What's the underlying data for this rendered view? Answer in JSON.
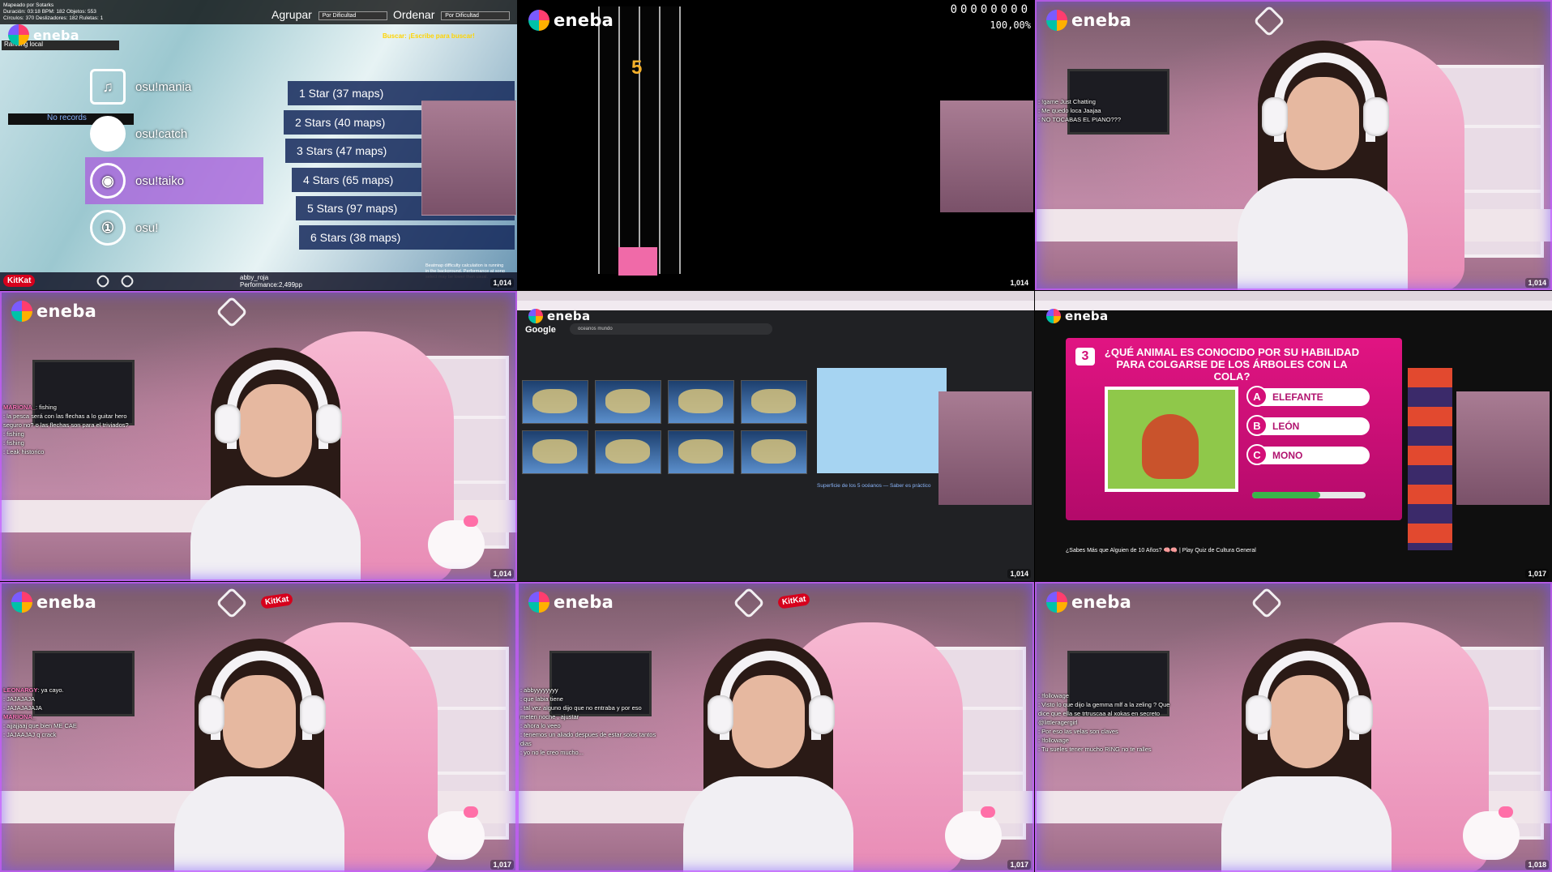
{
  "brand": {
    "eneba": "eneba",
    "kitkat": "KitKat"
  },
  "viewers": [
    "1,014",
    "1,014",
    "1,014",
    "1,014",
    "1,014",
    "1,017",
    "1,017",
    "1,017",
    "1,018"
  ],
  "osu": {
    "info_lines": [
      "Mapeado por Sotarks",
      "Duración: 03:18 BPM: 182 Objetos: 553",
      "Círculos: 370 Deslizadores: 182 Ruletas: 1"
    ],
    "group_label": "Agrupar",
    "group_value": "Por Dificultad",
    "order_label": "Ordenar",
    "order_value": "Por Dificultad",
    "ranking": "Ranking local",
    "search": "Buscar: ¡Escribe para buscar!",
    "no_records": "No records",
    "modes": [
      {
        "label": "osu!mania",
        "icon": "piano-icon"
      },
      {
        "label": "osu!catch",
        "icon": "apple-icon"
      },
      {
        "label": "osu!taiko",
        "icon": "drum-icon"
      },
      {
        "label": "osu!",
        "icon": "osu-circle-icon"
      }
    ],
    "mode_glyphs": [
      "♫",
      "",
      "◉",
      "①"
    ],
    "stars": [
      "1 Star (37 maps)",
      "2 Stars (40 maps)",
      "3 Stars (47 maps)",
      "4 Stars (65 maps)",
      "5 Stars (97 maps)",
      "6 Stars (38 maps)"
    ],
    "player": "abby_roja",
    "player_sub": "Performance:2,499pp",
    "tooltip": "Beatmap difficulty calculation is running in the background. Performance at song select may be lower than usual."
  },
  "mania": {
    "combo": "5",
    "score": "00000000",
    "accuracy": "100,00%"
  },
  "google": {
    "logo": "Google",
    "query": "oceanos mundo",
    "panel_title": "Superficie de los 5 océanos — Saber es práctico"
  },
  "quiz": {
    "number": "3",
    "question": "¿QUÉ ANIMAL ES CONOCIDO POR SU HABILIDAD PARA COLGARSE DE LOS ÁRBOLES CON LA COLA?",
    "options": [
      {
        "letter": "A",
        "text": "ELEFANTE"
      },
      {
        "letter": "B",
        "text": "LEÓN"
      },
      {
        "letter": "C",
        "text": "MONO"
      }
    ],
    "timer_fraction": 0.6,
    "video_title": "¿Sabes Más que Alguien de 10 Años? 🧠🧠 | Play Quiz de Cultura General"
  },
  "chats": {
    "t2": [
      {
        "u": "",
        "m": ": !game Just Chatting"
      },
      {
        "u": "",
        "m": ": Me quedo loca Jaajaa"
      },
      {
        "u": "",
        "m": ": NO TOCABAS EL PIANO???"
      }
    ],
    "t3": [
      {
        "u": "MARIONA_",
        "m": ": fishing"
      },
      {
        "u": "",
        "m": ": la pesca será con las flechas a lo guitar hero seguro no? o las flechas son para el triviados?"
      },
      {
        "u": "",
        "m": ": fishing"
      },
      {
        "u": "",
        "m": ": fishing"
      },
      {
        "u": "",
        "m": ": Leak historico"
      }
    ],
    "t6": [
      {
        "u": "LEONARGY",
        "m": ": ya cayo."
      },
      {
        "u": "",
        "m": ": JAJAJAJA"
      },
      {
        "u": "",
        "m": ": JAJAJAJAJA"
      },
      {
        "u": "MARIONA_",
        "m": ""
      },
      {
        "u": "",
        "m": ": ajjajjaaj que bien ME CAE"
      },
      {
        "u": "",
        "m": ": JAJAAJAJ q crack"
      }
    ],
    "t7": [
      {
        "u": "",
        "m": ": abbyyyyyyyy"
      },
      {
        "u": "",
        "m": ": que labia tiene"
      },
      {
        "u": "",
        "m": ": tal vez alguno dijo que no entraba y por eso meten noche , ajustar"
      },
      {
        "u": "",
        "m": ": ahora lo veeo"
      },
      {
        "u": "",
        "m": ": tenemos un aliado despues de estar solos tantos dias"
      },
      {
        "u": "",
        "m": ": yo no le creo mucho..."
      }
    ],
    "t8": [
      {
        "u": "",
        "m": ": !followage"
      },
      {
        "u": "",
        "m": ": Visto lo que dijo la gemma mlf a la zeling ? Que dice que ella se trtruscaa al xokas en secreto @littleragergirl"
      },
      {
        "u": "",
        "m": ": Por eso las velas son claves"
      },
      {
        "u": "",
        "m": ": !followage"
      },
      {
        "u": "",
        "m": ": Tu sueles tener mucho RING no te ralles"
      }
    ]
  }
}
